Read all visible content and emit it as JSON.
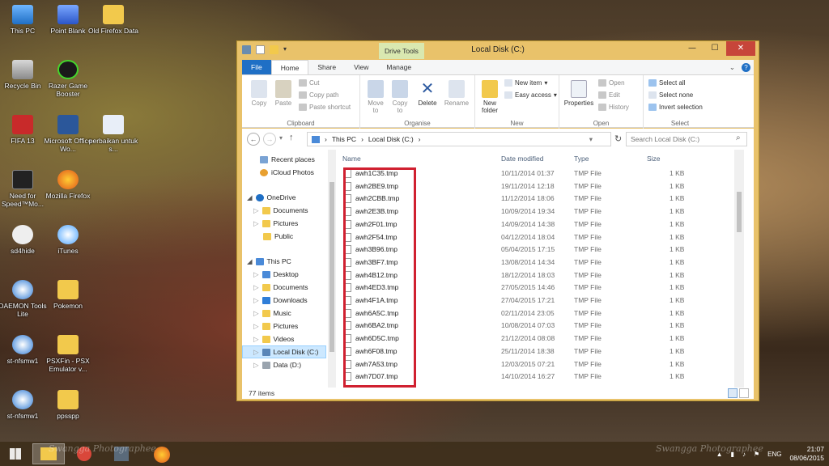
{
  "desktop": {
    "icons": [
      {
        "label": "This PC"
      },
      {
        "label": "Point Blank"
      },
      {
        "label": "Old Firefox Data"
      },
      {
        "label": "Recycle Bin"
      },
      {
        "label": "Razer Game Booster"
      },
      {
        "label": "FIFA 13"
      },
      {
        "label": "Microsoft Office Wo..."
      },
      {
        "label": "perbaikan untuk s..."
      },
      {
        "label": "Need for Speed™Mo..."
      },
      {
        "label": "Mozilla Firefox"
      },
      {
        "label": "sd4hide"
      },
      {
        "label": "iTunes"
      },
      {
        "label": "DAEMON Tools Lite"
      },
      {
        "label": "Pokemon"
      },
      {
        "label": "st-nfsmw1"
      },
      {
        "label": "PSXFin - PSX Emulator v..."
      },
      {
        "label": "st-nfsmw1"
      },
      {
        "label": "ppsspp"
      }
    ]
  },
  "window": {
    "title": "Local Disk (C:)",
    "contextual_tab": "Drive Tools",
    "controls": {
      "minimize": "—",
      "maximize": "☐",
      "close": "✕"
    },
    "tabs": [
      "File",
      "Home",
      "Share",
      "View",
      "Manage"
    ],
    "ribbon": {
      "clipboard": {
        "label": "Clipboard",
        "copy": "Copy",
        "paste": "Paste",
        "cut": "Cut",
        "copy_path": "Copy path",
        "paste_shortcut": "Paste shortcut"
      },
      "organise": {
        "label": "Organise",
        "move_to": "Move to",
        "copy_to": "Copy to",
        "delete": "Delete",
        "rename": "Rename"
      },
      "new": {
        "label": "New",
        "new_folder": "New folder",
        "new_item": "New item",
        "easy_access": "Easy access"
      },
      "open": {
        "label": "Open",
        "properties": "Properties",
        "open": "Open",
        "edit": "Edit",
        "history": "History"
      },
      "select": {
        "label": "Select",
        "select_all": "Select all",
        "select_none": "Select none",
        "invert": "Invert selection"
      }
    },
    "address": {
      "path": [
        "This PC",
        "Local Disk (C:)"
      ],
      "search_placeholder": "Search Local Disk (C:)"
    },
    "nav": [
      {
        "label": "Recent places"
      },
      {
        "label": "iCloud Photos"
      },
      {
        "label": "OneDrive"
      },
      {
        "label": "Documents"
      },
      {
        "label": "Pictures"
      },
      {
        "label": "Public"
      },
      {
        "label": "This PC"
      },
      {
        "label": "Desktop"
      },
      {
        "label": "Documents"
      },
      {
        "label": "Downloads"
      },
      {
        "label": "Music"
      },
      {
        "label": "Pictures"
      },
      {
        "label": "Videos"
      },
      {
        "label": "Local Disk (C:)"
      },
      {
        "label": "Data (D:)"
      }
    ],
    "columns": {
      "name": "Name",
      "date": "Date modified",
      "type": "Type",
      "size": "Size"
    },
    "files": [
      {
        "name": "awh1C35.tmp",
        "date": "10/11/2014 01:37",
        "type": "TMP File",
        "size": "1 KB"
      },
      {
        "name": "awh2BE9.tmp",
        "date": "19/11/2014 12:18",
        "type": "TMP File",
        "size": "1 KB"
      },
      {
        "name": "awh2CBB.tmp",
        "date": "11/12/2014 18:06",
        "type": "TMP File",
        "size": "1 KB"
      },
      {
        "name": "awh2E3B.tmp",
        "date": "10/09/2014 19:34",
        "type": "TMP File",
        "size": "1 KB"
      },
      {
        "name": "awh2F01.tmp",
        "date": "14/09/2014 14:38",
        "type": "TMP File",
        "size": "1 KB"
      },
      {
        "name": "awh2F54.tmp",
        "date": "04/12/2014 18:04",
        "type": "TMP File",
        "size": "1 KB"
      },
      {
        "name": "awh3B96.tmp",
        "date": "05/04/2015 17:15",
        "type": "TMP File",
        "size": "1 KB"
      },
      {
        "name": "awh3BF7.tmp",
        "date": "13/08/2014 14:34",
        "type": "TMP File",
        "size": "1 KB"
      },
      {
        "name": "awh4B12.tmp",
        "date": "18/12/2014 18:03",
        "type": "TMP File",
        "size": "1 KB"
      },
      {
        "name": "awh4ED3.tmp",
        "date": "27/05/2015 14:46",
        "type": "TMP File",
        "size": "1 KB"
      },
      {
        "name": "awh4F1A.tmp",
        "date": "27/04/2015 17:21",
        "type": "TMP File",
        "size": "1 KB"
      },
      {
        "name": "awh6A5C.tmp",
        "date": "02/11/2014 23:05",
        "type": "TMP File",
        "size": "1 KB"
      },
      {
        "name": "awh6BA2.tmp",
        "date": "10/08/2014 07:03",
        "type": "TMP File",
        "size": "1 KB"
      },
      {
        "name": "awh6D5C.tmp",
        "date": "21/12/2014 08:08",
        "type": "TMP File",
        "size": "1 KB"
      },
      {
        "name": "awh6F08.tmp",
        "date": "25/11/2014 18:38",
        "type": "TMP File",
        "size": "1 KB"
      },
      {
        "name": "awh7A53.tmp",
        "date": "12/03/2015 07:21",
        "type": "TMP File",
        "size": "1 KB"
      },
      {
        "name": "awh7D07.tmp",
        "date": "14/10/2014 16:27",
        "type": "TMP File",
        "size": "1 KB"
      }
    ],
    "status": "77 items"
  },
  "taskbar": {
    "language": "ENG",
    "time": "21:07",
    "date": "08/06/2015"
  },
  "watermark": "Swangga Photographee"
}
